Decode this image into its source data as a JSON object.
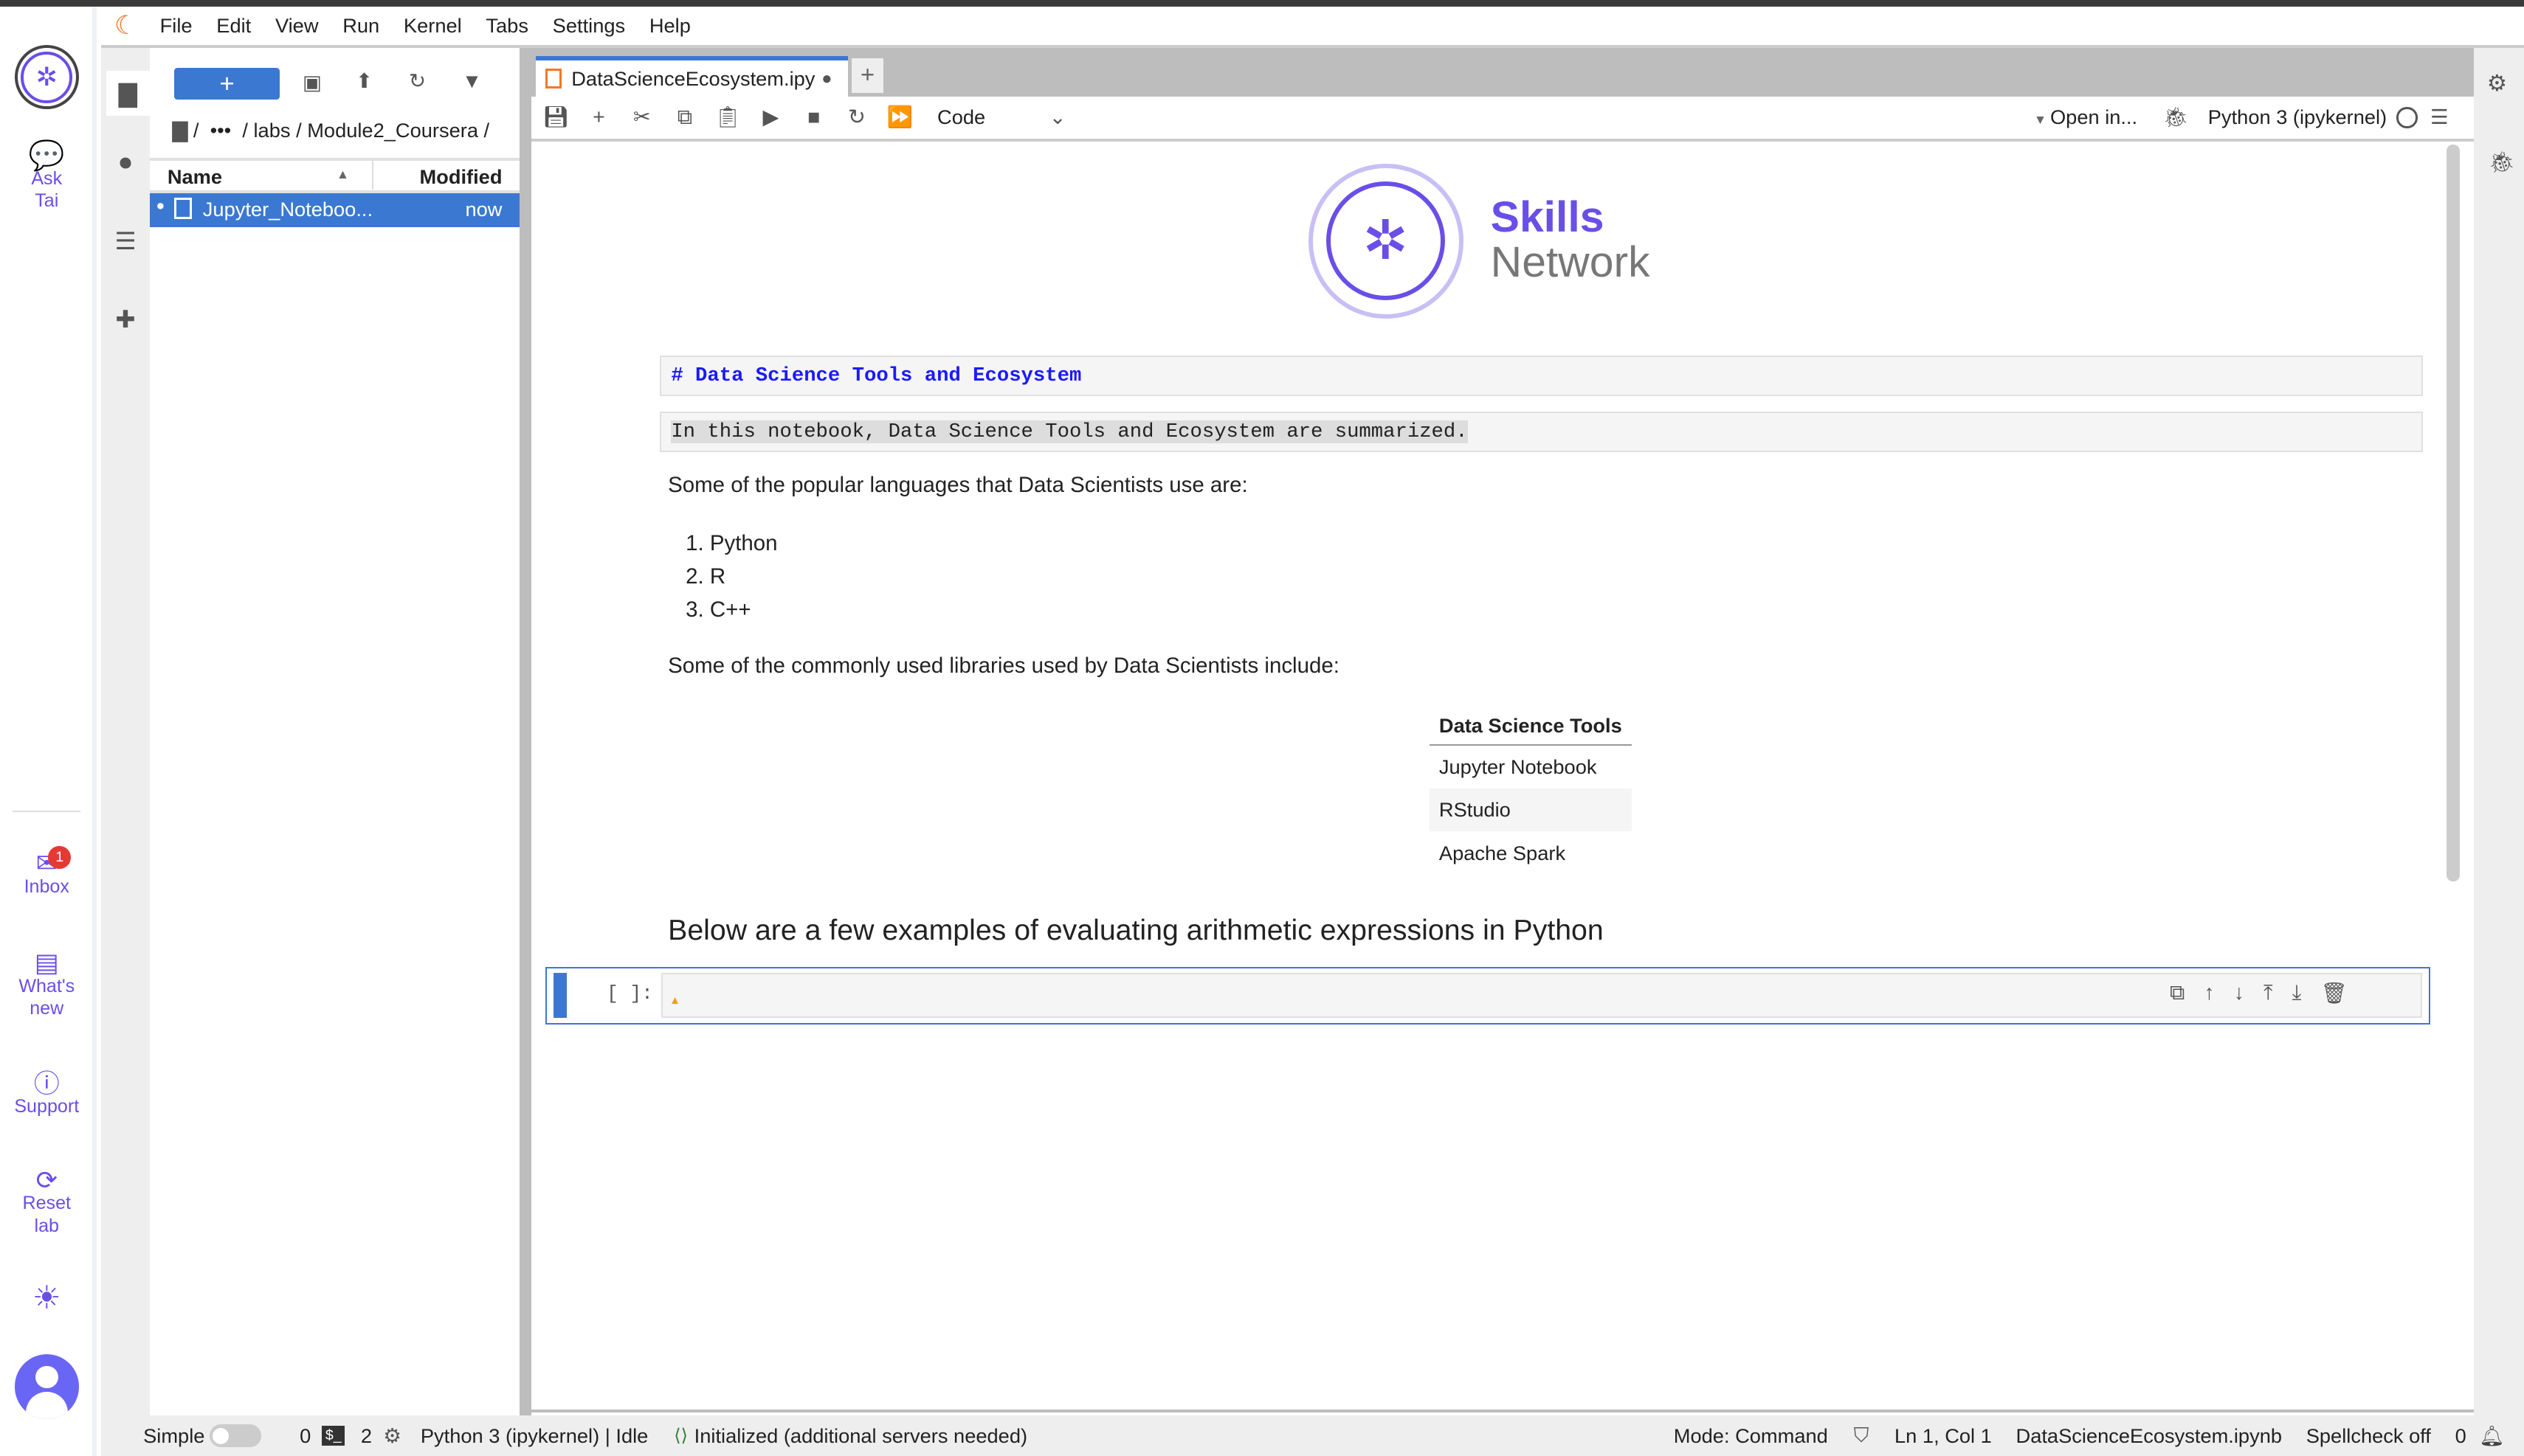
{
  "menu": [
    "File",
    "Edit",
    "View",
    "Run",
    "Kernel",
    "Tabs",
    "Settings",
    "Help"
  ],
  "left_strip": {
    "ask": "Ask Tai",
    "inbox": "Inbox",
    "inbox_badge": "1",
    "whats_new": "What's new",
    "support": "Support",
    "reset": "Reset lab"
  },
  "filebrowser": {
    "new_label": "+",
    "breadcrumb": "/  •••  / labs / Module2_Coursera /",
    "col_name": "Name",
    "col_modified": "Modified",
    "files": [
      {
        "name": "Jupyter_Noteboo...",
        "modified": "now"
      }
    ]
  },
  "tab": {
    "title": "DataScienceEcosystem.ipy",
    "add": "+"
  },
  "toolbar": {
    "cell_type": "Code",
    "open_in": "Open in...",
    "kernel": "Python 3 (ipykernel)"
  },
  "notebook": {
    "logo": {
      "line1": "Skills",
      "line2": "Network"
    },
    "heading_md": "# Data Science Tools and Ecosystem",
    "intro_md": "In this notebook, Data Science Tools and Ecosystem are summarized.",
    "languages_intro": "Some of the popular languages that Data Scientists use are:",
    "languages": [
      "Python",
      "R",
      "C++"
    ],
    "libraries_intro": "Some of the commonly used libraries used by Data Scientists include:",
    "table": {
      "header": "Data Science Tools",
      "rows": [
        "Jupyter Notebook",
        "RStudio",
        "Apache Spark"
      ]
    },
    "arith_heading": "Below are a few examples of evaluating arithmetic expressions in Python",
    "prompt": "[ ]:"
  },
  "status": {
    "mode_label": "Simple",
    "terminals": "0",
    "kernels": "2",
    "kernel_status": "Python 3 (ipykernel) | Idle",
    "lsp": "Initialized (additional servers needed)",
    "mode": "Mode: Command",
    "position": "Ln 1, Col 1",
    "file": "DataScienceEcosystem.ipynb",
    "spellcheck": "Spellcheck off",
    "notifications": "0"
  },
  "colors": {
    "accent": "#3b78d1",
    "brand": "#6a4ee8",
    "orange": "#f37726"
  }
}
